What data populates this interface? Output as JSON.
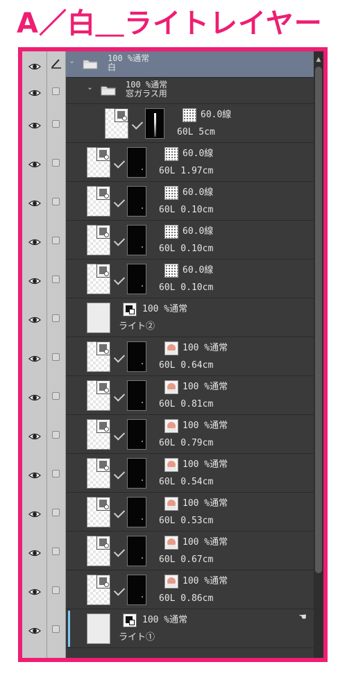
{
  "title": "A／白＿ライトレイヤー",
  "colors": {
    "accent": "#ee1e72",
    "panel": "#3a3a3a",
    "selected": "#6d7a90",
    "marker": "#7dc8f5"
  },
  "layers": [
    {
      "kind": "folder",
      "line1": "100 %通常",
      "line2": "白",
      "selected": true,
      "edit_icon": "pencil-icon"
    },
    {
      "kind": "folder",
      "line1": "100 %通常",
      "line2": "窓ガラス用",
      "indent": 1
    },
    {
      "kind": "vector",
      "prop": "60.0線",
      "detail": "60L 5cm",
      "indent": 2,
      "mask": "light-streak"
    },
    {
      "kind": "vector",
      "prop": "60.0線",
      "detail": "60L 1.97cm",
      "indent": 1
    },
    {
      "kind": "vector",
      "prop": "60.0線",
      "detail": "60L 0.10cm",
      "indent": 1
    },
    {
      "kind": "vector",
      "prop": "60.0線",
      "detail": "60L 0.10cm",
      "indent": 1
    },
    {
      "kind": "vector",
      "prop": "60.0線",
      "detail": "60L 0.10cm",
      "indent": 1
    },
    {
      "kind": "raster",
      "prop": "100 %通常",
      "detail": "ライト②",
      "indent": 1
    },
    {
      "kind": "color",
      "prop": "100 %通常",
      "detail": "60L 0.64cm",
      "indent": 1
    },
    {
      "kind": "color",
      "prop": "100 %通常",
      "detail": "60L 0.81cm",
      "indent": 1
    },
    {
      "kind": "color",
      "prop": "100 %通常",
      "detail": "60L 0.79cm",
      "indent": 1
    },
    {
      "kind": "color",
      "prop": "100 %通常",
      "detail": "60L 0.54cm",
      "indent": 1
    },
    {
      "kind": "color",
      "prop": "100 %通常",
      "detail": "60L 0.53cm",
      "indent": 1
    },
    {
      "kind": "color",
      "prop": "100 %通常",
      "detail": "60L 0.67cm",
      "indent": 1
    },
    {
      "kind": "color",
      "prop": "100 %通常",
      "detail": "60L 0.86cm",
      "indent": 1
    },
    {
      "kind": "raster",
      "prop": "100 %通常",
      "detail": "ライト①",
      "indent": 1,
      "marker": true,
      "corner_icon": "hand-icon"
    }
  ]
}
